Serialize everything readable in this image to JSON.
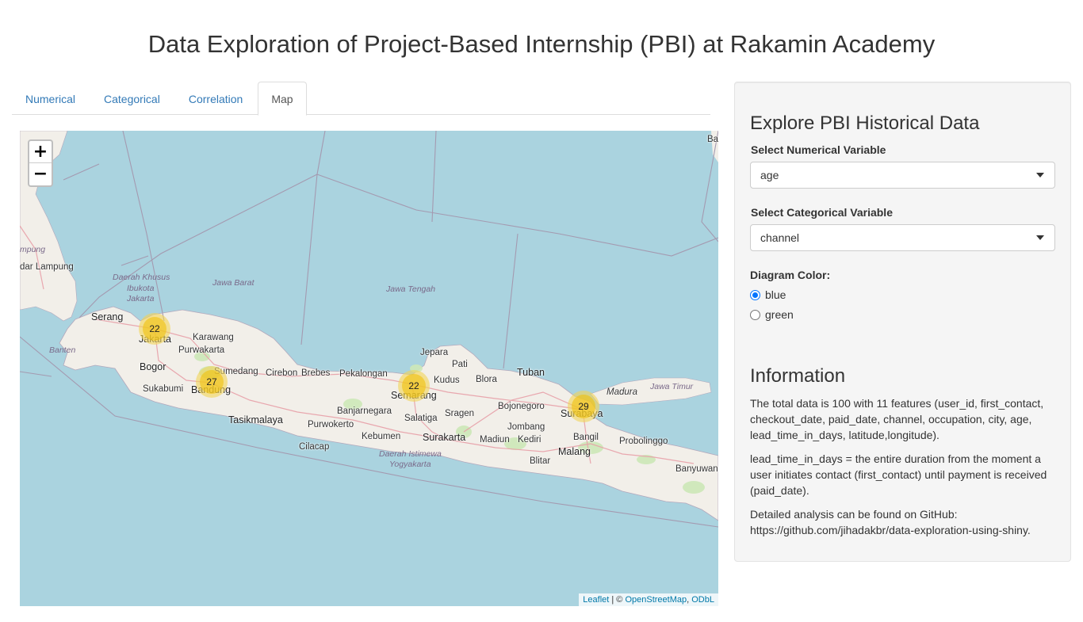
{
  "page": {
    "title": "Data Exploration of Project-Based Internship (PBI) at Rakamin Academy"
  },
  "tabs": [
    {
      "label": "Numerical",
      "active": false
    },
    {
      "label": "Categorical",
      "active": false
    },
    {
      "label": "Correlation",
      "active": false
    },
    {
      "label": "Map",
      "active": true
    }
  ],
  "map": {
    "zoom_in": "+",
    "zoom_out": "−",
    "attribution": {
      "leaflet": "Leaflet",
      "sep": " | © ",
      "osm": "OpenStreetMap",
      "comma": ", ",
      "odbl": "ODbL"
    },
    "clusters": [
      {
        "city": "Jakarta",
        "count": "22"
      },
      {
        "city": "Bandung",
        "count": "27"
      },
      {
        "city": "Semarang",
        "count": "22"
      },
      {
        "city": "Surabaya",
        "count": "29"
      }
    ],
    "labels": {
      "lampung_partial": "mpung",
      "bandar_lampung": "dar Lampung",
      "dki1": "Daerah Khusus",
      "dki2": "Ibukota",
      "dki3": "Jakarta",
      "jawa_barat": "Jawa Barat",
      "jawa_tengah": "Jawa Tengah",
      "jawa_timur": "Jawa Timur",
      "banten": "Banten",
      "diy1": "Daerah Istimewa",
      "diy2": "Yogyakarta",
      "madura": "Madura",
      "serang": "Serang",
      "jakarta": "Jakarta",
      "karawang": "Karawang",
      "purwakarta": "Purwakarta",
      "bogor": "Bogor",
      "sumedang": "Sumedang",
      "sukabumi": "Sukabumi",
      "bandung": "Bandung",
      "cirebon": "Cirebon",
      "brebes": "Brebes",
      "pekalongan": "Pekalongan",
      "tasikmalaya": "Tasikmalaya",
      "banjarnegara": "Banjarnegara",
      "purwokerto": "Purwokerto",
      "cilacap": "Cilacap",
      "kebumen": "Kebumen",
      "jepara": "Jepara",
      "pati": "Pati",
      "kudus": "Kudus",
      "semarang": "Semarang",
      "salatiga": "Salatiga",
      "sragen": "Sragen",
      "surakarta": "Surakarta",
      "blora": "Blora",
      "tuban": "Tuban",
      "bojonegoro": "Bojonegoro",
      "madiun": "Madiun",
      "jombang": "Jombang",
      "kediri": "Kediri",
      "surabaya": "Surabaya",
      "bangil": "Bangil",
      "probolinggo": "Probolinggo",
      "malang": "Malang",
      "blitar": "Blitar",
      "banyuwangi": "Banyuwang",
      "bali_partial": "Ba"
    }
  },
  "sidebar": {
    "heading": "Explore PBI Historical Data",
    "numerical_label": "Select Numerical Variable",
    "numerical_value": "age",
    "categorical_label": "Select Categorical Variable",
    "categorical_value": "channel",
    "color_label": "Diagram Color:",
    "color_options": [
      {
        "label": "blue",
        "checked": true
      },
      {
        "label": "green",
        "checked": false
      }
    ],
    "info_heading": "Information",
    "info_p1": "The total data is 100 with 11 features (user_id, first_contact, checkout_date, paid_date, channel, occupation, city, age, lead_time_in_days, latitude,longitude).",
    "info_p2": "lead_time_in_days = the entire duration from the moment a user initiates contact (first_contact) until payment is received (paid_date).",
    "info_p3": "Detailed analysis can be found on GitHub: https://github.com/jihadakbr/data-exploration-using-shiny."
  }
}
